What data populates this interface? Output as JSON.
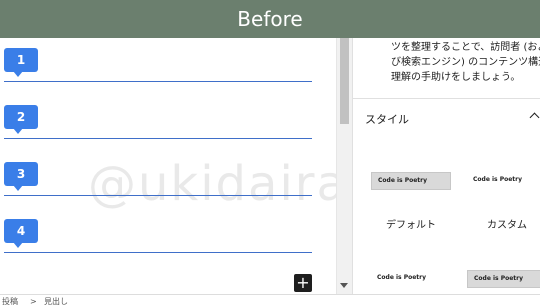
{
  "banner": {
    "title": "Before"
  },
  "editor": {
    "headings": [
      {
        "badge": "1"
      },
      {
        "badge": "2"
      },
      {
        "badge": "3"
      },
      {
        "badge": "4"
      }
    ],
    "add_label": "+"
  },
  "sidebar": {
    "description_lines": [
      "ツを整理することで、訪問者 (およ",
      "び検索エンジン) のコンテンツ構造",
      "理解の手助けをしましょう。"
    ],
    "style_title": "スタイル",
    "styles": [
      {
        "preview": "Code is Poetry",
        "label": "デフォルト"
      },
      {
        "preview": "Code is Poetry",
        "label": "カスタム"
      },
      {
        "preview": "Code is Poetry"
      },
      {
        "preview": "Code is Poetry"
      }
    ]
  },
  "breadcrumb": [
    "投稿",
    ">",
    "見出し"
  ],
  "watermark": "@ukidaira",
  "colors": {
    "banner": "#6b7f6e",
    "accent": "#3a7ee8",
    "line": "#3f6fc9"
  }
}
